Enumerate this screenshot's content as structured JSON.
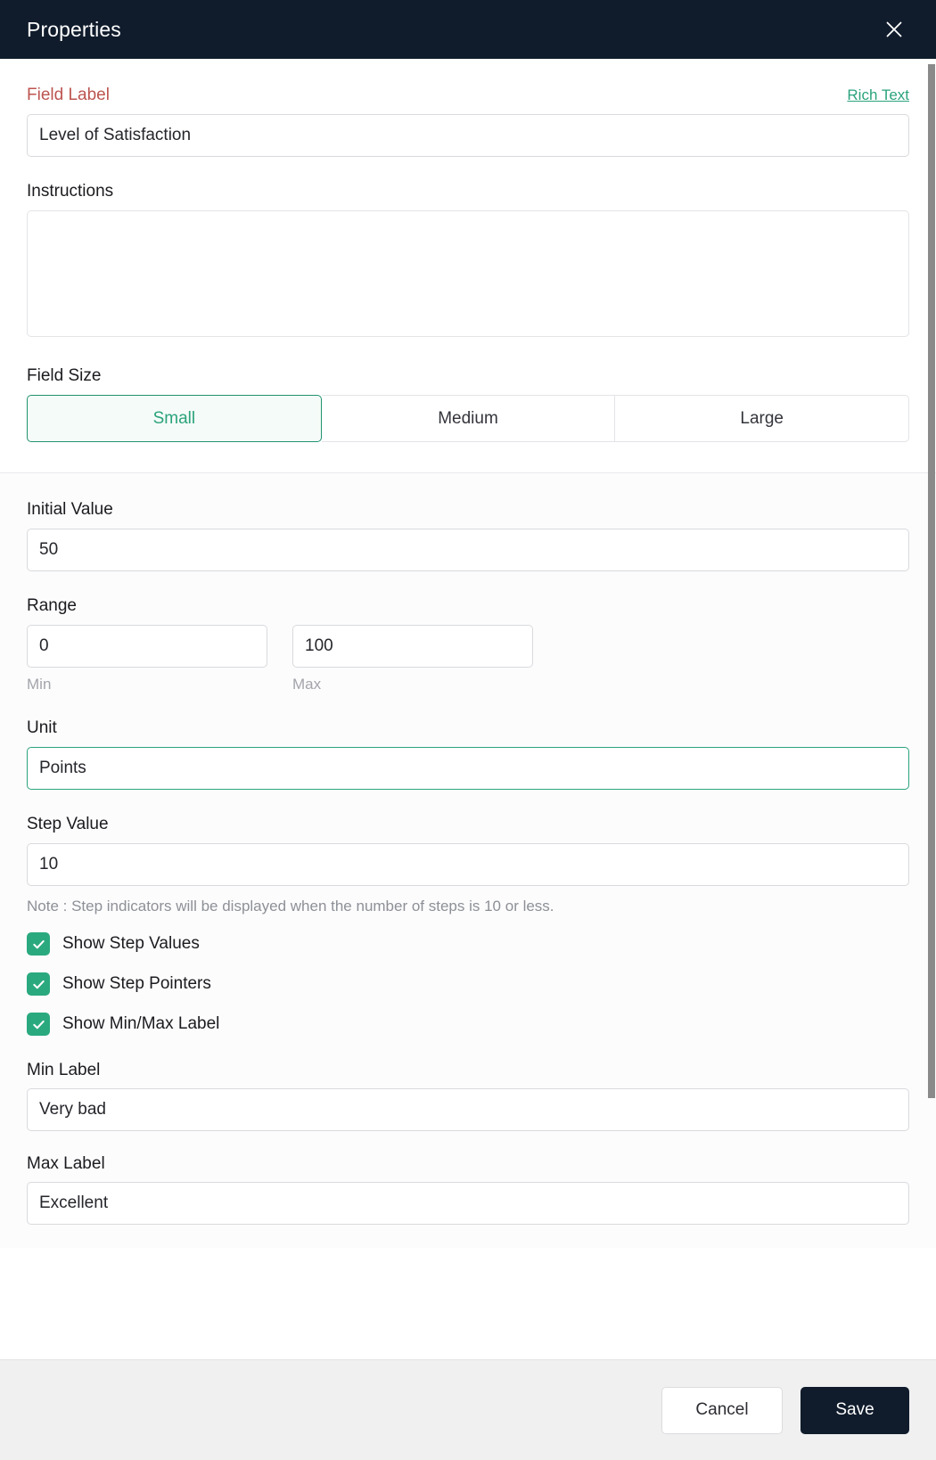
{
  "header": {
    "title": "Properties",
    "close_icon": "close-icon"
  },
  "form": {
    "field_label": {
      "label": "Field Label",
      "rich_text_link": "Rich Text",
      "value": "Level of Satisfaction"
    },
    "instructions": {
      "label": "Instructions",
      "value": "",
      "placeholder": ""
    },
    "field_size": {
      "label": "Field Size",
      "options": [
        "Small",
        "Medium",
        "Large"
      ],
      "selected": "Small"
    },
    "initial_value": {
      "label": "Initial Value",
      "value": "50"
    },
    "range": {
      "label": "Range",
      "min_value": "0",
      "max_value": "100",
      "min_sublabel": "Min",
      "max_sublabel": "Max"
    },
    "unit": {
      "label": "Unit",
      "value": "Points"
    },
    "step_value": {
      "label": "Step Value",
      "value": "10",
      "note": "Note : Step indicators will be displayed when the number of steps is 10 or less."
    },
    "checkboxes": [
      {
        "label": "Show Step Values",
        "checked": true
      },
      {
        "label": "Show Step Pointers",
        "checked": true
      },
      {
        "label": "Show Min/Max Label",
        "checked": true
      }
    ],
    "min_label": {
      "label": "Min Label",
      "value": "Very bad"
    },
    "max_label": {
      "label": "Max Label",
      "value": "Excellent"
    }
  },
  "footer": {
    "cancel_label": "Cancel",
    "save_label": "Save"
  },
  "colors": {
    "header_bg": "#101c2c",
    "accent_teal": "#2ba37d",
    "required_red": "#bc5450",
    "checkbox_green": "#2aa97f",
    "save_bg": "#101c2c"
  }
}
